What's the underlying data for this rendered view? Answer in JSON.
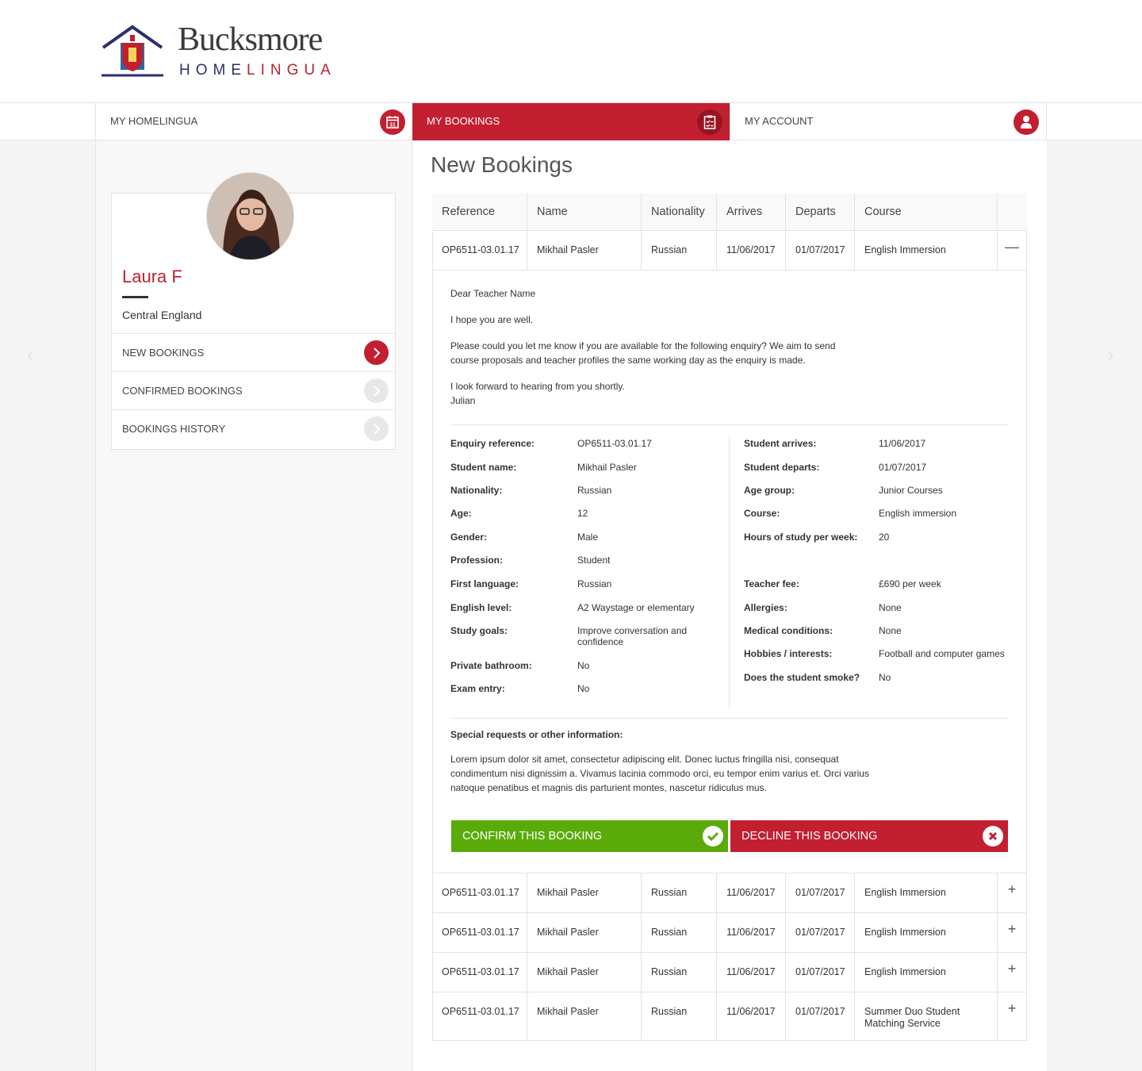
{
  "logo": {
    "word1": "Bucksmore",
    "word2_home": "HOME",
    "word2_lingua": "LINGUA"
  },
  "nav": [
    {
      "label": "My HomeLingua",
      "icon": "calendar-icon",
      "icon_text": "31"
    },
    {
      "label": "My Bookings",
      "icon": "checklist-icon"
    },
    {
      "label": "My Account",
      "icon": "user-icon"
    }
  ],
  "profile": {
    "name": "Laura F",
    "region": "Central England"
  },
  "sidebar": {
    "items": [
      {
        "label": "New Bookings",
        "active": true
      },
      {
        "label": "Confirmed Bookings",
        "active": false
      },
      {
        "label": "Bookings History",
        "active": false
      }
    ]
  },
  "main": {
    "title": "New Bookings"
  },
  "table": {
    "headers": [
      "Reference",
      "Name",
      "Nationality",
      "Arrives",
      "Departs",
      "Course"
    ],
    "expanded_row": {
      "reference": "OP6511-03.01.17",
      "name": "Mikhail Pasler",
      "nationality": "Russian",
      "arrives": "11/06/2017",
      "departs": "01/07/2017",
      "course": "English Immersion",
      "toggle": "—"
    },
    "rows": [
      {
        "reference": "OP6511-03.01.17",
        "name": "Mikhail Pasler",
        "nationality": "Russian",
        "arrives": "11/06/2017",
        "departs": "01/07/2017",
        "course": "English Immersion",
        "toggle": "+"
      },
      {
        "reference": "OP6511-03.01.17",
        "name": "Mikhail Pasler",
        "nationality": "Russian",
        "arrives": "11/06/2017",
        "departs": "01/07/2017",
        "course": "English Immersion",
        "toggle": "+"
      },
      {
        "reference": "OP6511-03.01.17",
        "name": "Mikhail Pasler",
        "nationality": "Russian",
        "arrives": "11/06/2017",
        "departs": "01/07/2017",
        "course": "English Immersion",
        "toggle": "+"
      },
      {
        "reference": "OP6511-03.01.17",
        "name": "Mikhail Pasler",
        "nationality": "Russian",
        "arrives": "11/06/2017",
        "departs": "01/07/2017",
        "course": "Summer Duo Student Matching Service",
        "toggle": "+"
      }
    ]
  },
  "letter": {
    "greeting": "Dear Teacher Name",
    "line1": "I hope you are well.",
    "line2": "Please could you let me know if you are available for the following enquiry? We aim to send course proposals and teacher profiles the same working day as the enquiry is made.",
    "line3": "I look forward to hearing from you shortly.",
    "signoff": "Julian"
  },
  "details_left": [
    {
      "k": "Enquiry reference:",
      "v": "OP6511-03.01.17"
    },
    {
      "k": "Student name:",
      "v": "Mikhail Pasler"
    },
    {
      "k": "Nationality:",
      "v": "Russian"
    },
    {
      "k": "Age:",
      "v": "12"
    },
    {
      "k": "Gender:",
      "v": "Male"
    },
    {
      "k": "Profession:",
      "v": "Student"
    },
    {
      "k": "First language:",
      "v": "Russian"
    },
    {
      "k": "English level:",
      "v": "A2 Waystage or elementary"
    },
    {
      "k": "Study goals:",
      "v": "Improve conversation and confidence"
    },
    {
      "k": "Private bathroom:",
      "v": "No"
    },
    {
      "k": "Exam entry:",
      "v": "No"
    }
  ],
  "details_right": [
    {
      "k": "Student arrives:",
      "v": "11/06/2017"
    },
    {
      "k": "Student departs:",
      "v": "01/07/2017"
    },
    {
      "k": "Age group:",
      "v": "Junior Courses"
    },
    {
      "k": "Course:",
      "v": "English immersion"
    },
    {
      "k": "Hours of study per week:",
      "v": "20"
    },
    {
      "k": "Teacher fee:",
      "v": "£690 per week"
    },
    {
      "k": "Allergies:",
      "v": "None"
    },
    {
      "k": "Medical conditions:",
      "v": "None"
    },
    {
      "k": "Hobbies / interests:",
      "v": "Football and computer games"
    },
    {
      "k": "Does the student smoke?",
      "v": "No"
    }
  ],
  "special": {
    "label": "Special requests or other information:",
    "text": "Lorem ipsum dolor sit amet, consectetur adipiscing elit. Donec luctus fringilla nisi, consequat condimentum nisi dignissim a. Vivamus lacinia commodo orci, eu tempor enim varius et. Orci varius natoque penatibus et magnis dis parturient montes, nascetur ridiculus mus."
  },
  "buttons": {
    "confirm": "Confirm this booking",
    "decline": "Decline this booking"
  },
  "colors": {
    "brand_red": "#c21f30",
    "confirm_green": "#5aab0a",
    "navy": "#2a2f6b"
  }
}
